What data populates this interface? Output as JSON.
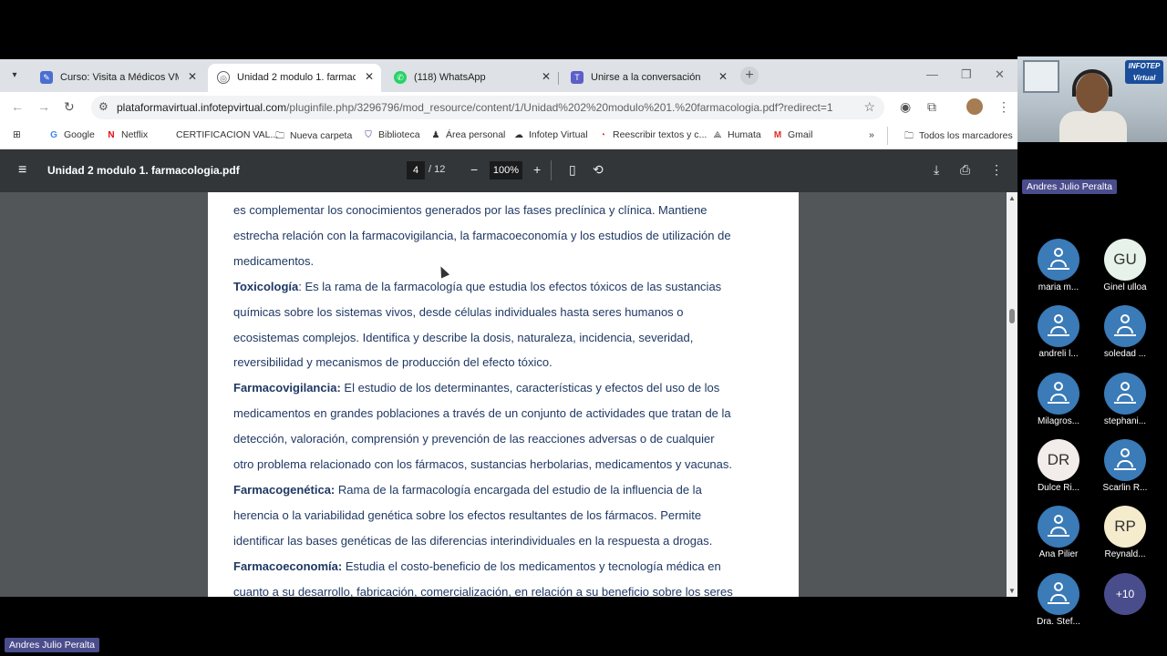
{
  "tabs": [
    {
      "title": "Curso: Visita a Médicos VM 25-",
      "icon": "moodle-icon",
      "color": "#4a6fd1"
    },
    {
      "title": "Unidad 2 modulo 1. farmacolog",
      "icon": "globe-icon",
      "color": "#5f6368"
    },
    {
      "title": "(118) WhatsApp",
      "icon": "whatsapp-icon",
      "color": "#25d366"
    },
    {
      "title": "Unirse a la conversación",
      "icon": "teams-icon",
      "color": "#5b5fc7"
    }
  ],
  "url": {
    "domain": "plataformavirtual.infotepvirtual.com",
    "path": "/pluginfile.php/3296796/mod_resource/content/1/Unidad%202%20modulo%201.%20farmacologia.pdf?redirect=1"
  },
  "bookmarks": [
    {
      "label": "Google"
    },
    {
      "label": "Netflix"
    },
    {
      "label": "CERTIFICACION VAL..."
    },
    {
      "label": "Nueva carpeta"
    },
    {
      "label": "Biblioteca"
    },
    {
      "label": "Área personal"
    },
    {
      "label": "Infotep Virtual"
    },
    {
      "label": "Reescribir textos y c..."
    },
    {
      "label": "Humata"
    },
    {
      "label": "Gmail"
    }
  ],
  "bookmarks_more": "»",
  "all_bookmarks": "Todos los marcadores",
  "pdf": {
    "filename": "Unidad 2 modulo 1. farmacologia.pdf",
    "page": "4",
    "total": "/ 12",
    "zoom": "100%",
    "lines": [
      {
        "bold": "",
        "text": "es complementar los conocimientos generados por las fases preclínica y clínica. Mantiene"
      },
      {
        "bold": "",
        "text": "estrecha relación con la farmacovigilancia, la farmacoeconomía y los estudios de utilización de"
      },
      {
        "bold": "",
        "text": "medicamentos."
      },
      {
        "bold": "Toxicología",
        "text": ": Es la rama de la farmacología que estudia los efectos tóxicos de las sustancias"
      },
      {
        "bold": "",
        "text": "químicas sobre los sistemas vivos, desde células individuales hasta seres humanos o"
      },
      {
        "bold": "",
        "text": "ecosistemas complejos. Identifica y describe la dosis, naturaleza, incidencia, severidad,"
      },
      {
        "bold": "",
        "text": "reversibilidad y mecanismos de producción del efecto tóxico."
      },
      {
        "bold": "Farmacovigilancia:",
        "text": " El estudio de los determinantes, características y efectos del uso de los"
      },
      {
        "bold": "",
        "text": "medicamentos en grandes poblaciones a través de un conjunto de actividades que tratan de la"
      },
      {
        "bold": "",
        "text": "detección, valoración, comprensión y prevención de las reacciones adversas o de cualquier"
      },
      {
        "bold": "",
        "text": "otro problema relacionado con los fármacos, sustancias herbolarias, medicamentos y vacunas."
      },
      {
        "bold": "Farmacogenética:",
        "text": " Rama de la farmacología encargada del estudio de la influencia de la"
      },
      {
        "bold": "",
        "text": "herencia o la variabilidad genética sobre los efectos resultantes de los fármacos. Permite"
      },
      {
        "bold": "",
        "text": "identificar las bases genéticas de las diferencias interindividuales en la respuesta a drogas."
      },
      {
        "bold": "Farmacoeconomía:",
        "text": " Estudia el costo-beneficio de los medicamentos y tecnología médica en"
      },
      {
        "bold": "",
        "text": "cuanto a su desarrollo, fabricación, comercialización, en relación a su beneficio sobre los seres"
      }
    ]
  },
  "meeting": {
    "presenter": "Andres Julio Peralta",
    "video_logo": "INFOTEP Virtual",
    "participants": [
      {
        "name": "maria m...",
        "initials": "",
        "color": "#3a7bb8"
      },
      {
        "name": "Ginel ulloa",
        "initials": "GU",
        "color": "#e6f2ea"
      },
      {
        "name": "andreli l...",
        "initials": "",
        "color": "#3a7bb8"
      },
      {
        "name": "soledad ...",
        "initials": "",
        "color": "#3a7bb8"
      },
      {
        "name": "Milagros...",
        "initials": "",
        "color": "#3a7bb8"
      },
      {
        "name": "stephani...",
        "initials": "",
        "color": "#3a7bb8"
      },
      {
        "name": "Dulce Ri...",
        "initials": "DR",
        "color": "#f2ecea"
      },
      {
        "name": "Scarlin R...",
        "initials": "",
        "color": "#3a7bb8"
      },
      {
        "name": "Ana Pilier",
        "initials": "",
        "color": "#3a7bb8"
      },
      {
        "name": "Reynald...",
        "initials": "RP",
        "color": "#f5eccd"
      },
      {
        "name": "Dra. Stef...",
        "initials": "",
        "color": "#3a7bb8"
      }
    ],
    "more_count": "+10"
  }
}
